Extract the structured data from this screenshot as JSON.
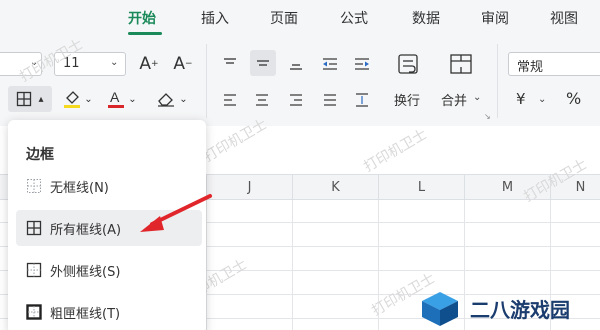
{
  "tabs": [
    {
      "label": "开始",
      "active": true
    },
    {
      "label": "插入"
    },
    {
      "label": "页面"
    },
    {
      "label": "公式"
    },
    {
      "label": "数据"
    },
    {
      "label": "审阅"
    },
    {
      "label": "视图"
    }
  ],
  "ribbon": {
    "font_size": "11",
    "grow_font_label": "A",
    "shrink_font_label": "A",
    "wrap_label": "换行",
    "merge_label": "合并",
    "number_format": "常规",
    "currency_symbol": "¥",
    "percent_symbol": "%"
  },
  "columns": [
    "J",
    "K",
    "L",
    "M",
    "N"
  ],
  "watermark": "打印机卫士",
  "borders_menu": {
    "title": "边框",
    "items": [
      {
        "label": "无框线(N)"
      },
      {
        "label": "所有框线(A)",
        "highlighted": true
      },
      {
        "label": "外侧框线(S)"
      },
      {
        "label": "粗匣框线(T)"
      }
    ]
  },
  "brand": {
    "text": "二八游戏园"
  },
  "colors": {
    "accent": "#1a8a5a",
    "arrow": "#e0262b",
    "font_color": "#d9262b",
    "highlight": "#f5d91f"
  }
}
